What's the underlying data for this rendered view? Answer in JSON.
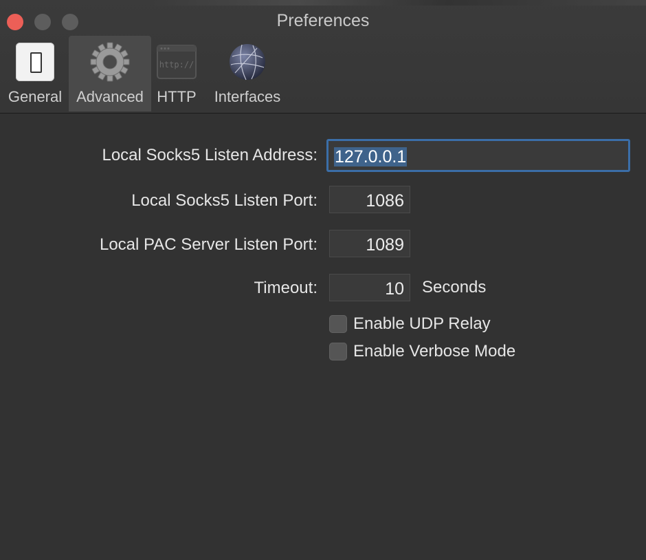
{
  "window": {
    "title": "Preferences"
  },
  "toolbar": {
    "items": [
      {
        "label": "General",
        "icon": "general-switch-icon",
        "selected": false
      },
      {
        "label": "Advanced",
        "icon": "gear-icon",
        "selected": true
      },
      {
        "label": "HTTP",
        "icon": "http-icon",
        "selected": false
      },
      {
        "label": "Interfaces",
        "icon": "globe-network-icon",
        "selected": false
      }
    ]
  },
  "form": {
    "address_label": "Local Socks5 Listen Address:",
    "address_value": "127.0.0.1",
    "port_label": "Local Socks5 Listen Port:",
    "port_value": "1086",
    "pac_label": "Local PAC Server Listen Port:",
    "pac_value": "1089",
    "timeout_label": "Timeout:",
    "timeout_value": "10",
    "timeout_suffix": "Seconds",
    "udp_label": "Enable UDP Relay",
    "udp_checked": false,
    "verbose_label": "Enable Verbose Mode",
    "verbose_checked": false
  },
  "colors": {
    "close_button": "#ec5f57",
    "selection": "#3f638b",
    "focus_ring": "#3b6ea8"
  }
}
